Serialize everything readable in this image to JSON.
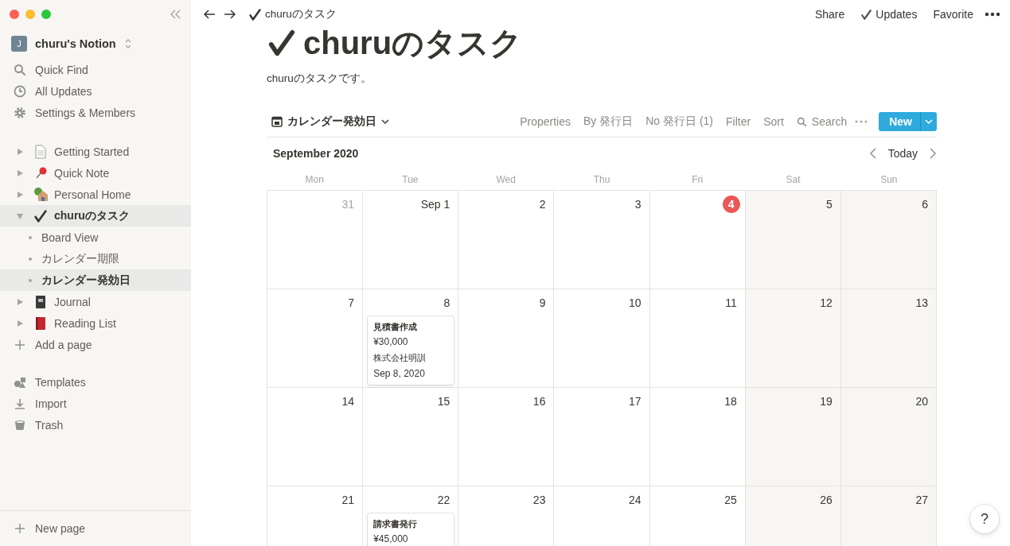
{
  "sidebar": {
    "workspace": {
      "initial": "J",
      "name": "churu's Notion"
    },
    "top_items": [
      {
        "label": "Quick Find"
      },
      {
        "label": "All Updates"
      },
      {
        "label": "Settings & Members"
      }
    ],
    "pages": [
      {
        "label": "Getting Started",
        "expanded": false,
        "selected": false
      },
      {
        "label": "Quick Note",
        "expanded": false,
        "selected": false
      },
      {
        "label": "Personal Home",
        "expanded": false,
        "selected": false
      },
      {
        "label": "churuのタスク",
        "expanded": true,
        "selected": true,
        "children": [
          {
            "label": "Board View",
            "selected": false
          },
          {
            "label": "カレンダー期限",
            "selected": false
          },
          {
            "label": "カレンダー発効日",
            "selected": true
          }
        ]
      },
      {
        "label": "Journal",
        "expanded": false,
        "selected": false
      },
      {
        "label": "Reading List",
        "expanded": false,
        "selected": false
      }
    ],
    "add_page": "Add a page",
    "bottom_items": [
      {
        "label": "Templates"
      },
      {
        "label": "Import"
      },
      {
        "label": "Trash"
      }
    ],
    "new_page": "New page"
  },
  "topbar": {
    "breadcrumb": "churuのタスク",
    "actions": [
      {
        "label": "Share",
        "kind": "plain"
      },
      {
        "label": "Updates",
        "kind": "check"
      },
      {
        "label": "Favorite",
        "kind": "plain"
      }
    ]
  },
  "page": {
    "title": "churuのタスク",
    "description": "churuのタスクです。"
  },
  "view": {
    "name": "カレンダー発効日",
    "tools": [
      {
        "label": "Properties",
        "kind": "plain"
      },
      {
        "label": "By 発行日",
        "kind": "plain"
      },
      {
        "label": "No 発行日 (1)",
        "kind": "plain"
      },
      {
        "label": "Filter",
        "kind": "plain"
      },
      {
        "label": "Sort",
        "kind": "plain"
      },
      {
        "label": "Search",
        "kind": "search"
      }
    ],
    "new_button": "New"
  },
  "calendar": {
    "month": "September 2020",
    "today_button": "Today",
    "weekdays": [
      {
        "label": "Mon",
        "weekend": false
      },
      {
        "label": "Tue",
        "weekend": false
      },
      {
        "label": "Wed",
        "weekend": false
      },
      {
        "label": "Thu",
        "weekend": false
      },
      {
        "label": "Fri",
        "weekend": false
      },
      {
        "label": "Sat",
        "weekend": true
      },
      {
        "label": "Sun",
        "weekend": true
      }
    ],
    "weeks": [
      [
        {
          "day": "31",
          "other_month": true,
          "today": false
        },
        {
          "day": "Sep 1",
          "other_month": false,
          "today": false
        },
        {
          "day": "2",
          "other_month": false,
          "today": false
        },
        {
          "day": "3",
          "other_month": false,
          "today": false
        },
        {
          "day": "4",
          "other_month": false,
          "today": true
        },
        {
          "day": "5",
          "other_month": false,
          "today": false
        },
        {
          "day": "6",
          "other_month": false,
          "today": false
        }
      ],
      [
        {
          "day": "7",
          "other_month": false,
          "today": false
        },
        {
          "day": "8",
          "other_month": false,
          "today": false,
          "events": [
            {
              "title": "見積書作成",
              "fields": [
                {
                  "kind": "number",
                  "text": "¥30,000"
                },
                {
                  "kind": "text",
                  "text": "株式会社明訓"
                },
                {
                  "kind": "date",
                  "text": "Sep 8, 2020"
                }
              ]
            }
          ]
        },
        {
          "day": "9",
          "other_month": false,
          "today": false
        },
        {
          "day": "10",
          "other_month": false,
          "today": false
        },
        {
          "day": "11",
          "other_month": false,
          "today": false
        },
        {
          "day": "12",
          "other_month": false,
          "today": false
        },
        {
          "day": "13",
          "other_month": false,
          "today": false
        }
      ],
      [
        {
          "day": "14",
          "other_month": false,
          "today": false
        },
        {
          "day": "15",
          "other_month": false,
          "today": false
        },
        {
          "day": "16",
          "other_month": false,
          "today": false
        },
        {
          "day": "17",
          "other_month": false,
          "today": false
        },
        {
          "day": "18",
          "other_month": false,
          "today": false
        },
        {
          "day": "19",
          "other_month": false,
          "today": false
        },
        {
          "day": "20",
          "other_month": false,
          "today": false
        }
      ],
      [
        {
          "day": "21",
          "other_month": false,
          "today": false
        },
        {
          "day": "22",
          "other_month": false,
          "today": false,
          "events": [
            {
              "title": "請求書発行",
              "fields": [
                {
                  "kind": "number",
                  "text": "¥45,000"
                }
              ]
            }
          ]
        },
        {
          "day": "23",
          "other_month": false,
          "today": false
        },
        {
          "day": "24",
          "other_month": false,
          "today": false
        },
        {
          "day": "25",
          "other_month": false,
          "today": false
        },
        {
          "day": "26",
          "other_month": false,
          "today": false
        },
        {
          "day": "27",
          "other_month": false,
          "today": false
        }
      ]
    ]
  },
  "help": {
    "label": "?"
  }
}
